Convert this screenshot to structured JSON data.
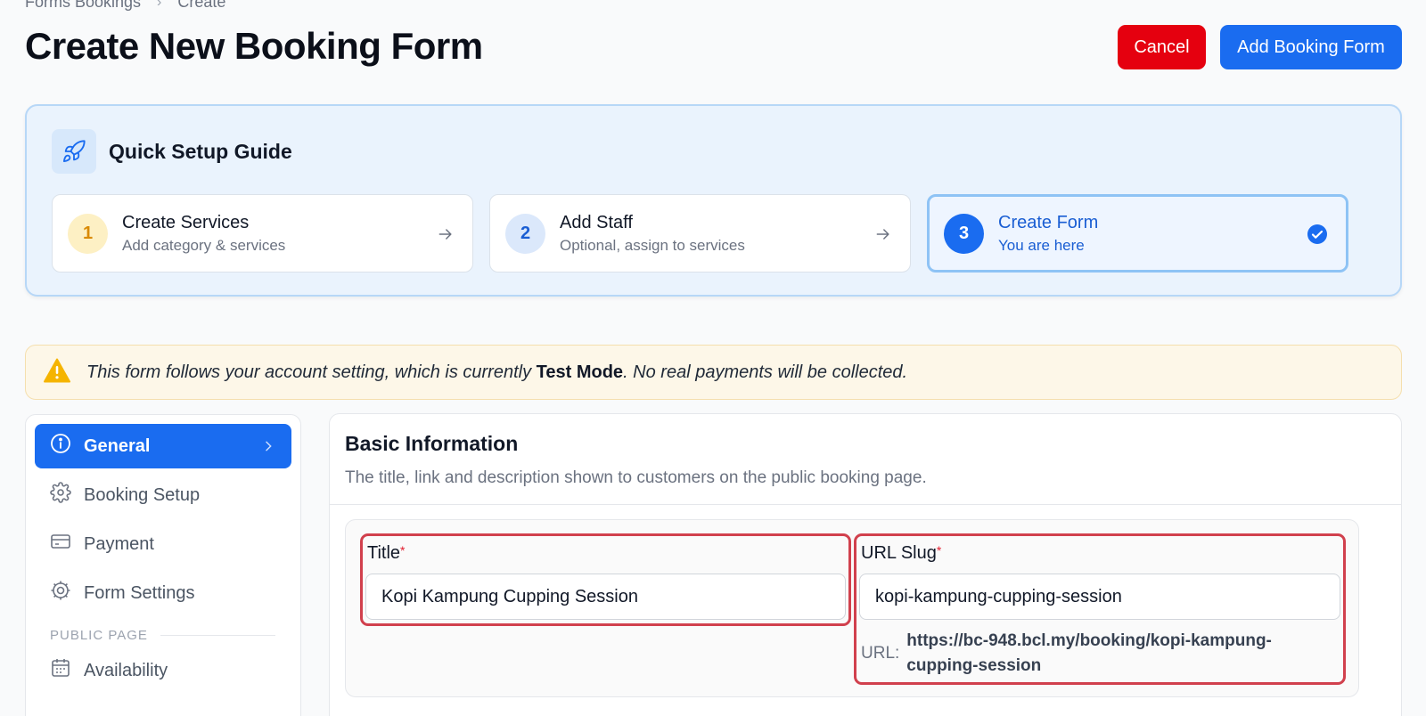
{
  "breadcrumb": {
    "items": [
      "Forms Bookings",
      "Create"
    ]
  },
  "page": {
    "title": "Create New Booking Form"
  },
  "header": {
    "cancel_label": "Cancel",
    "add_label": "Add Booking Form"
  },
  "guide": {
    "title": "Quick Setup Guide",
    "steps": [
      {
        "num": "1",
        "title": "Create Services",
        "subtitle": "Add category & services"
      },
      {
        "num": "2",
        "title": "Add Staff",
        "subtitle": "Optional, assign to services"
      },
      {
        "num": "3",
        "title": "Create Form",
        "subtitle": "You are here"
      }
    ]
  },
  "notice": {
    "prefix": "This form follows your account setting, which is currently ",
    "mode": "Test Mode",
    "suffix": ". No real payments will be collected."
  },
  "nav": {
    "items": [
      {
        "label": "General",
        "icon": "info-icon"
      },
      {
        "label": "Booking Setup",
        "icon": "gear-icon"
      },
      {
        "label": "Payment",
        "icon": "credit-card-icon"
      },
      {
        "label": "Form Settings",
        "icon": "cog-icon"
      },
      {
        "label": "Availability",
        "icon": "calendar-icon"
      }
    ],
    "section_public": "PUBLIC PAGE"
  },
  "basic": {
    "title": "Basic Information",
    "description": "The title, link and description shown to customers on the public booking page.",
    "title_label": "Title",
    "title_value": "Kopi Kampung Cupping Session",
    "slug_label": "URL Slug",
    "slug_value": "kopi-kampung-cupping-session",
    "url_label": "URL:",
    "url_value": "https://bc-948.bcl.my/booking/kopi-kampung-cupping-session"
  },
  "colors": {
    "primary": "#1a6cf0",
    "danger": "#e5000f",
    "warning": "#f5b400",
    "highlight_border": "#d1404d"
  }
}
